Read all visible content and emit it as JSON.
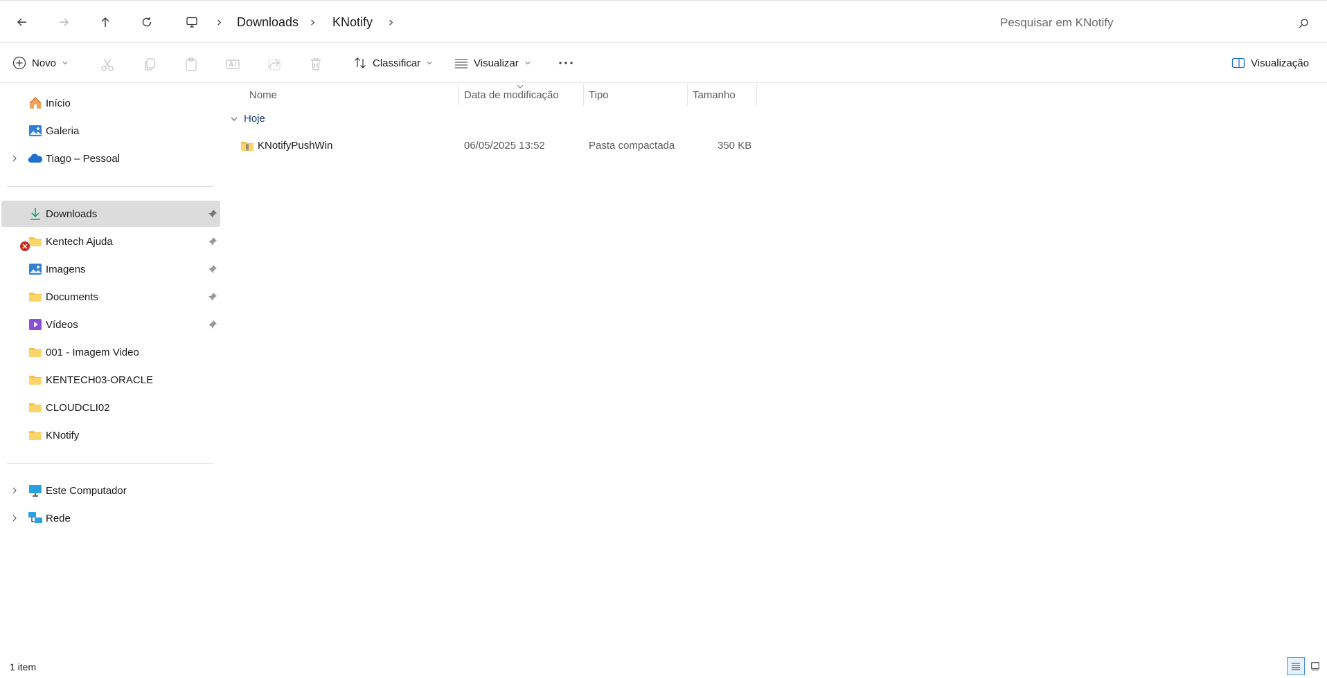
{
  "address": {
    "breadcrumb": [
      "Downloads",
      "KNotify"
    ],
    "search_placeholder": "Pesquisar em KNotify"
  },
  "toolbar": {
    "new_label": "Novo",
    "sort_label": "Classificar",
    "view_label": "Visualizar",
    "preview_label": "Visualização"
  },
  "sidebar": {
    "items": [
      {
        "label": "Início",
        "icon": "home-icon"
      },
      {
        "label": "Galeria",
        "icon": "gallery-icon"
      },
      {
        "label": "Tiago – Pessoal",
        "icon": "onedrive-cloud-icon"
      },
      {
        "label": "Downloads",
        "icon": "download-arrow-icon"
      },
      {
        "label": "Kentech Ajuda",
        "icon": "folder-icon"
      },
      {
        "label": "Imagens",
        "icon": "pictures-icon"
      },
      {
        "label": "Documents",
        "icon": "folder-icon"
      },
      {
        "label": "Vídeos",
        "icon": "videos-icon"
      },
      {
        "label": "001 - Imagem Video",
        "icon": "folder-icon"
      },
      {
        "label": "KENTECH03-ORACLE",
        "icon": "folder-icon"
      },
      {
        "label": "CLOUDCLI02",
        "icon": "folder-icon"
      },
      {
        "label": "KNotify",
        "icon": "folder-icon"
      },
      {
        "label": "Este Computador",
        "icon": "computer-icon"
      },
      {
        "label": "Rede",
        "icon": "network-icon"
      }
    ]
  },
  "columns": {
    "name": "Nome",
    "date": "Data de modificação",
    "type": "Tipo",
    "size": "Tamanho"
  },
  "group": {
    "label": "Hoje"
  },
  "files": [
    {
      "name": "KNotifyPushWin",
      "date": "06/05/2025 13:52",
      "type": "Pasta compactada",
      "size": "350 KB"
    }
  ],
  "status": {
    "count": "1 item"
  },
  "colors": {
    "folder": "#f5c342",
    "selected": "#dcdcdc",
    "accent": "#1f6fd1"
  }
}
